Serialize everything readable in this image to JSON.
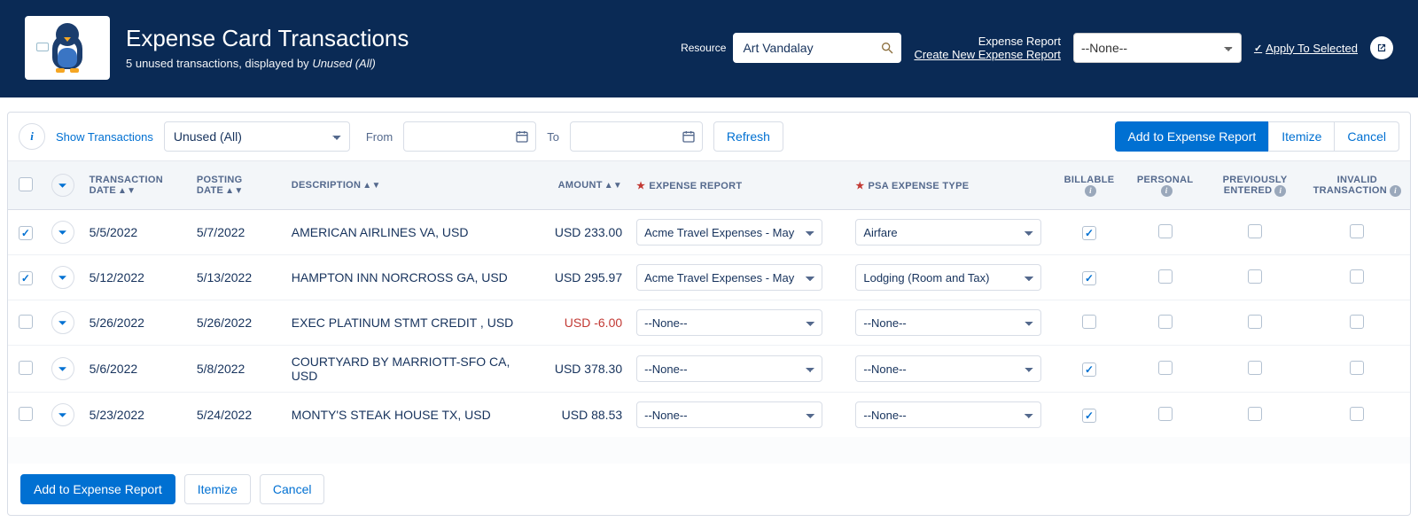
{
  "header": {
    "title": "Expense Card Transactions",
    "subtitle_prefix": "5 unused transactions, displayed by ",
    "subtitle_em": "Unused (All)",
    "resource_label": "Resource",
    "resource_value": "Art Vandalay",
    "expense_report_label": "Expense Report",
    "create_link": "Create New Expense Report",
    "report_select": "--None--",
    "apply_label": "Apply To Selected"
  },
  "toolbar": {
    "show_label": "Show Transactions",
    "filter": "Unused (All)",
    "from_label": "From",
    "to_label": "To",
    "refresh": "Refresh",
    "add": "Add to Expense Report",
    "itemize": "Itemize",
    "cancel": "Cancel"
  },
  "columns": {
    "transaction_date": "TRANSACTION DATE",
    "posting_date": "POSTING DATE",
    "description": "DESCRIPTION",
    "amount": "AMOUNT",
    "expense_report": "EXPENSE REPORT",
    "psa_expense_type": "PSA EXPENSE TYPE",
    "billable": "BILLABLE",
    "personal": "PERSONAL",
    "previously_entered": "PREVIOUSLY ENTERED",
    "invalid_transaction": "INVALID TRANSACTION"
  },
  "rows": [
    {
      "checked": true,
      "tdate": "5/5/2022",
      "pdate": "5/7/2022",
      "desc": "AMERICAN AIRLINES VA, USD",
      "amount": "USD 233.00",
      "neg": false,
      "report": "Acme Travel Expenses - May",
      "type": "Airfare",
      "billable": true,
      "personal": false,
      "prev": false,
      "invalid": false
    },
    {
      "checked": true,
      "tdate": "5/12/2022",
      "pdate": "5/13/2022",
      "desc": "HAMPTON INN NORCROSS GA, USD",
      "amount": "USD 295.97",
      "neg": false,
      "report": "Acme Travel Expenses - May",
      "type": "Lodging (Room and Tax)",
      "billable": true,
      "personal": false,
      "prev": false,
      "invalid": false
    },
    {
      "checked": false,
      "tdate": "5/26/2022",
      "pdate": "5/26/2022",
      "desc": "EXEC PLATINUM STMT CREDIT , USD",
      "amount": "USD -6.00",
      "neg": true,
      "report": "--None--",
      "type": "--None--",
      "billable": false,
      "personal": false,
      "prev": false,
      "invalid": false
    },
    {
      "checked": false,
      "tdate": "5/6/2022",
      "pdate": "5/8/2022",
      "desc": "COURTYARD BY MARRIOTT-SFO CA, USD",
      "amount": "USD 378.30",
      "neg": false,
      "report": "--None--",
      "type": "--None--",
      "billable": true,
      "personal": false,
      "prev": false,
      "invalid": false
    },
    {
      "checked": false,
      "tdate": "5/23/2022",
      "pdate": "5/24/2022",
      "desc": "MONTY'S STEAK HOUSE TX, USD",
      "amount": "USD 88.53",
      "neg": false,
      "report": "--None--",
      "type": "--None--",
      "billable": true,
      "personal": false,
      "prev": false,
      "invalid": false
    }
  ],
  "footer": {
    "add": "Add to Expense Report",
    "itemize": "Itemize",
    "cancel": "Cancel"
  }
}
